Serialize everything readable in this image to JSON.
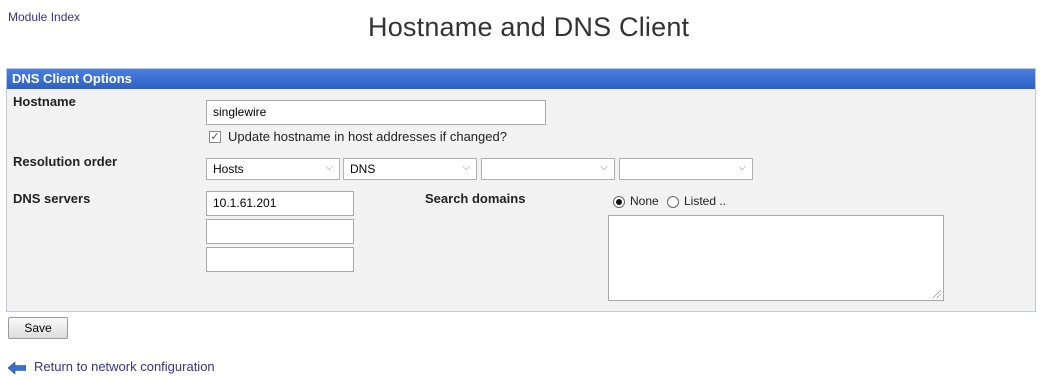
{
  "header": {
    "module_index": "Module Index",
    "title": "Hostname and DNS Client"
  },
  "panel": {
    "title": "DNS Client Options",
    "hostname": {
      "label": "Hostname",
      "value": "singlewire",
      "update_checkbox_label": "Update hostname in host addresses if changed?",
      "update_checked": true
    },
    "resolution": {
      "label": "Resolution order",
      "selects": [
        "Hosts",
        "DNS",
        "",
        ""
      ]
    },
    "dns": {
      "label": "DNS servers",
      "servers": [
        "10.1.61.201",
        "",
        ""
      ]
    },
    "search": {
      "label": "Search domains",
      "option_none": "None",
      "option_listed": "Listed ..",
      "selected": "None",
      "domains_text": ""
    }
  },
  "actions": {
    "save_label": "Save",
    "return_label": "Return to network configuration"
  },
  "colors": {
    "header_bar": "#3b6fcf",
    "link": "#333399",
    "panel_bg": "#f2f2f2"
  },
  "icons": {
    "return": "arrow-left-icon",
    "checkbox": "checkbox-checked-icon"
  }
}
